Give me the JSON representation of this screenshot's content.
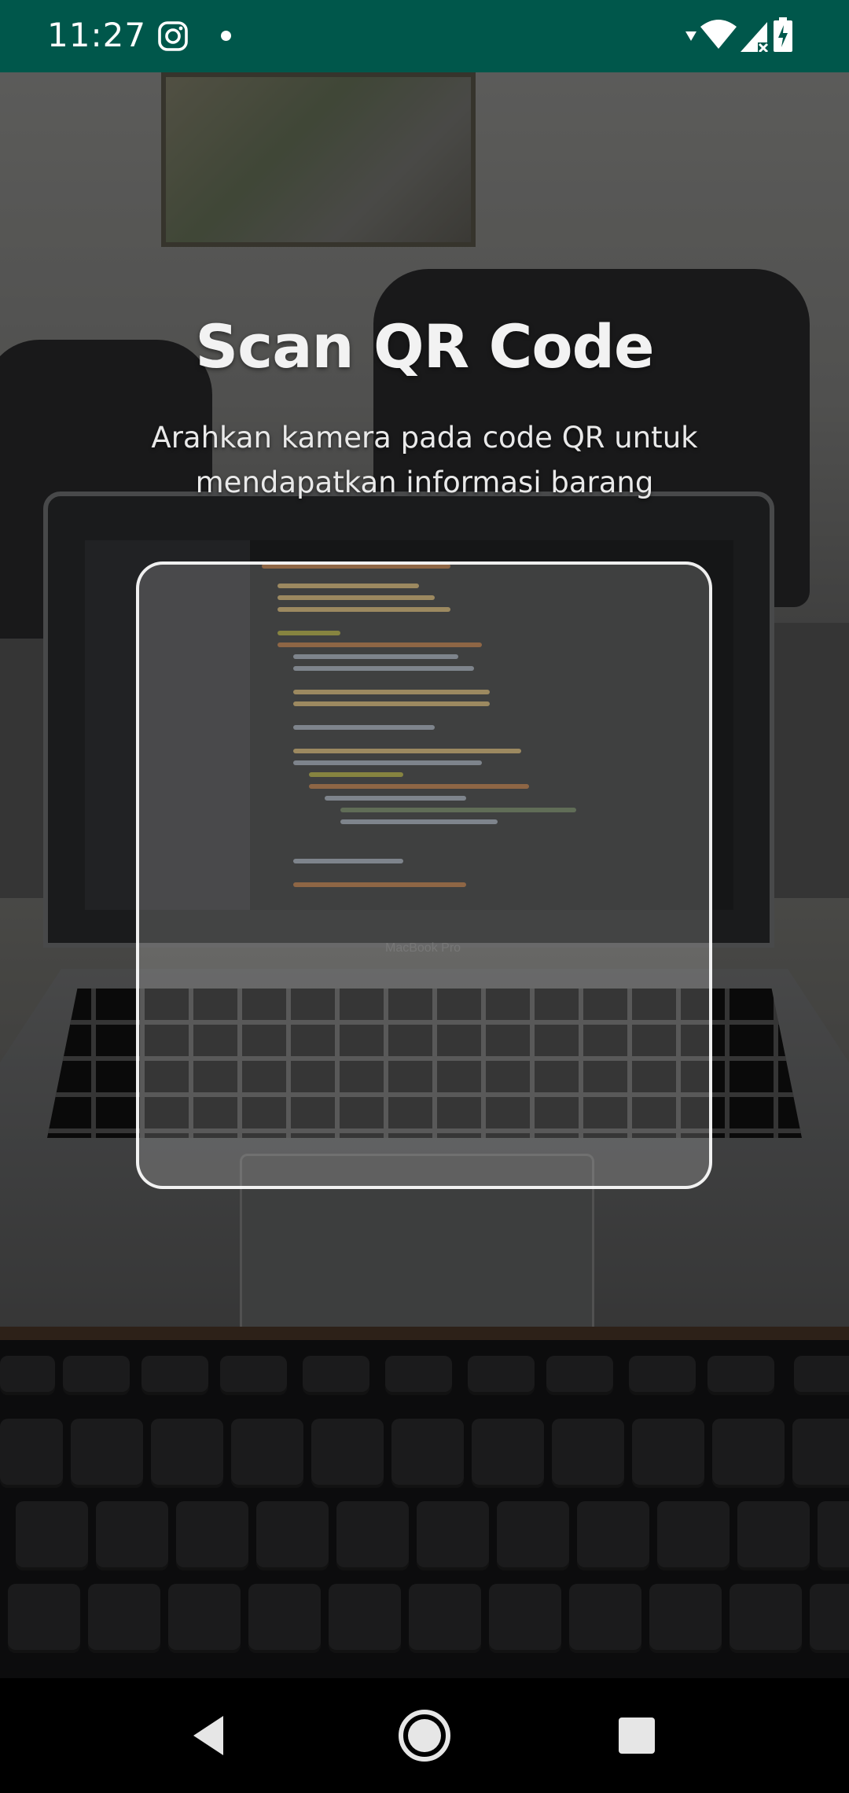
{
  "status_bar": {
    "time": "11:27",
    "icons": [
      "instagram-icon",
      "notification-dot-icon",
      "signal-arrow-icon",
      "wifi-icon",
      "cellular-no-signal-icon",
      "battery-charging-icon"
    ]
  },
  "scanner": {
    "title": "Scan QR Code",
    "subtitle_line1": "Arahkan kamera pada code QR untuk",
    "subtitle_line2": "mendapatkan informasi barang"
  },
  "camera_preview": {
    "laptop_label": "MacBook Pro"
  },
  "nav_bar": {
    "buttons": [
      "back-icon",
      "home-icon",
      "recents-icon"
    ]
  },
  "colors": {
    "status_bar": "#00574b",
    "title_text": "#f2f2f2",
    "frame_border": "#ffffff"
  }
}
